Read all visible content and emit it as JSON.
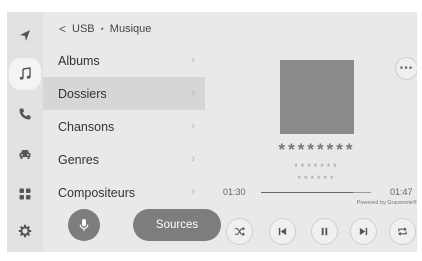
{
  "nav": {
    "items": [
      {
        "icon": "navigation-arrow-icon",
        "active": false
      },
      {
        "icon": "music-note-icon",
        "active": true
      },
      {
        "icon": "phone-icon",
        "active": false
      },
      {
        "icon": "car-icon",
        "active": false
      },
      {
        "icon": "apps-grid-icon",
        "active": false
      },
      {
        "icon": "gear-icon",
        "active": false
      }
    ]
  },
  "breadcrumb": {
    "back": "<",
    "source": "USB",
    "separator": "•",
    "section": "Musique"
  },
  "browse_list": {
    "items": [
      {
        "label": "Albums",
        "selected": false
      },
      {
        "label": "Dossiers",
        "selected": true
      },
      {
        "label": "Chansons",
        "selected": false
      },
      {
        "label": "Genres",
        "selected": false
      },
      {
        "label": "Compositeurs",
        "selected": false
      }
    ],
    "chevron": "›"
  },
  "footer": {
    "sources_label": "Sources",
    "mic_icon": "microphone-icon"
  },
  "player": {
    "more_label": "•••",
    "title": "********",
    "artist": "*******",
    "album": "******",
    "elapsed": "01:30",
    "duration": "01:47",
    "progress_fraction": 0.84,
    "powered_by": "Powered by Gracenote®",
    "controls": [
      "shuffle-icon",
      "previous-icon",
      "pause-icon",
      "next-icon",
      "repeat-icon"
    ]
  },
  "colors": {
    "screen_bg": "#e9e9e9",
    "sidebar_bg": "#e2e2e2",
    "selected_row": "#d6d6d6",
    "button_fill": "#7d7d7d",
    "album_art": "#8a8a8a"
  }
}
